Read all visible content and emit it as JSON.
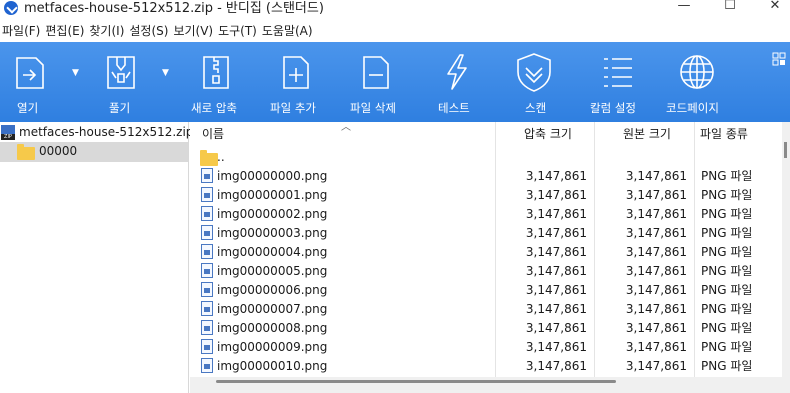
{
  "window": {
    "title": "metfaces-house-512x512.zip - 반디집 (스탠더드)",
    "minimize": "—",
    "maximize": "☐",
    "close": "✕"
  },
  "menu": [
    "파일(F)",
    "편집(E)",
    "찾기(I)",
    "설정(S)",
    "보기(V)",
    "도구(T)",
    "도움말(A)"
  ],
  "toolbar": {
    "open": "열기",
    "extract": "풀기",
    "new_archive": "새로 압축",
    "add_file": "파일 추가",
    "delete_file": "파일 삭제",
    "test": "테스트",
    "scan": "스캔",
    "column_settings": "칼럼 설정",
    "code_page": "코드페이지"
  },
  "tree": {
    "archive": "metfaces-house-512x512.zip",
    "folder": "00000"
  },
  "columns": {
    "name": "이름",
    "packed": "압축 크기",
    "original": "원본 크기",
    "type": "파일 종류"
  },
  "parent_entry": "..",
  "files": [
    {
      "name": "img00000000.png",
      "packed": "3,147,861",
      "original": "3,147,861",
      "type": "PNG 파일"
    },
    {
      "name": "img00000001.png",
      "packed": "3,147,861",
      "original": "3,147,861",
      "type": "PNG 파일"
    },
    {
      "name": "img00000002.png",
      "packed": "3,147,861",
      "original": "3,147,861",
      "type": "PNG 파일"
    },
    {
      "name": "img00000003.png",
      "packed": "3,147,861",
      "original": "3,147,861",
      "type": "PNG 파일"
    },
    {
      "name": "img00000004.png",
      "packed": "3,147,861",
      "original": "3,147,861",
      "type": "PNG 파일"
    },
    {
      "name": "img00000005.png",
      "packed": "3,147,861",
      "original": "3,147,861",
      "type": "PNG 파일"
    },
    {
      "name": "img00000006.png",
      "packed": "3,147,861",
      "original": "3,147,861",
      "type": "PNG 파일"
    },
    {
      "name": "img00000007.png",
      "packed": "3,147,861",
      "original": "3,147,861",
      "type": "PNG 파일"
    },
    {
      "name": "img00000008.png",
      "packed": "3,147,861",
      "original": "3,147,861",
      "type": "PNG 파일"
    },
    {
      "name": "img00000009.png",
      "packed": "3,147,861",
      "original": "3,147,861",
      "type": "PNG 파일"
    },
    {
      "name": "img00000010.png",
      "packed": "3,147,861",
      "original": "3,147,861",
      "type": "PNG 파일"
    }
  ]
}
